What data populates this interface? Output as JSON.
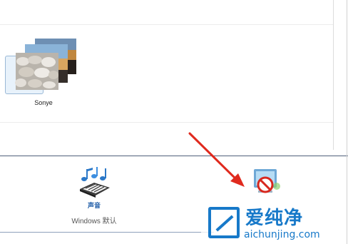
{
  "themes": [
    {
      "name": "Sonye"
    }
  ],
  "bottom_bar": {
    "sound": {
      "label": "声音",
      "value": "Windows 默认",
      "icon": "music-notes-keyboard-icon"
    },
    "screensaver": {
      "icon": "screensaver-disabled-icon"
    }
  },
  "annotation": {
    "arrow_color": "#e02a1e"
  },
  "watermark": {
    "title": "爱纯净",
    "url": "aichunjing.com",
    "color": "#1779c9"
  }
}
